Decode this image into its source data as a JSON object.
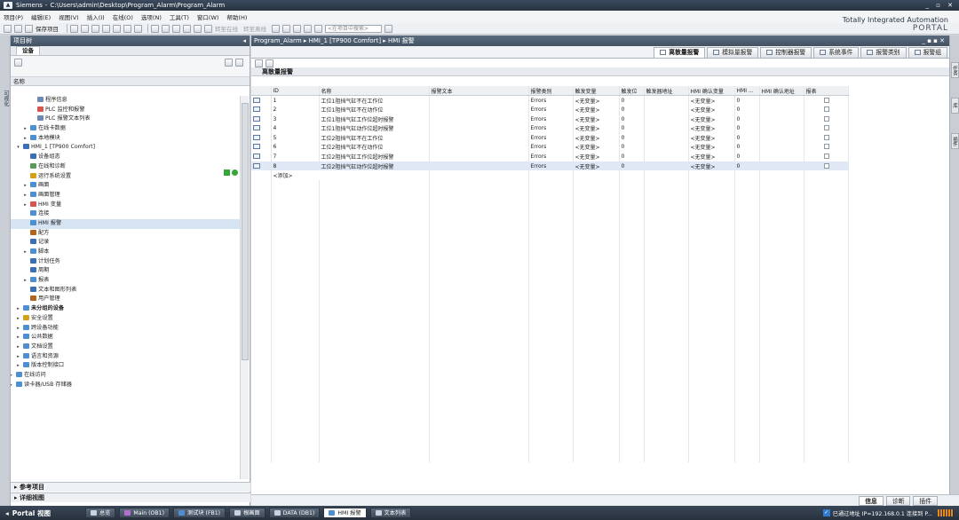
{
  "window": {
    "app": "Siemens",
    "path": "C:\\Users\\admin\\Desktop\\Program_Alarm\\Program_Alarm",
    "brand1": "Totally Integrated Automation",
    "brand2": "PORTAL"
  },
  "menu": [
    "项目(P)",
    "编辑(E)",
    "视图(V)",
    "插入(I)",
    "在线(O)",
    "选项(N)",
    "工具(T)",
    "窗口(W)",
    "帮助(H)"
  ],
  "toolbar": {
    "save": "保存项目",
    "online": "转至在线",
    "offline": "转至离线",
    "search_placeholder": "<在项目中搜索>"
  },
  "sidetab": "可视化",
  "project_tree": {
    "title": "项目树",
    "tab": "设备",
    "col_name": "名称",
    "items": [
      {
        "label": "程序信息",
        "level": 3,
        "arrow": "",
        "color": "#6e87b3"
      },
      {
        "label": "PLC 监控和报警",
        "level": 3,
        "arrow": "",
        "color": "#d9534f"
      },
      {
        "label": "PLC 报警文本列表",
        "level": 3,
        "arrow": "",
        "color": "#6e87b3"
      },
      {
        "label": "在线卡数据",
        "level": 2,
        "arrow": "▸",
        "color": "#4e8fd1"
      },
      {
        "label": "本地模块",
        "level": 2,
        "arrow": "▸",
        "color": "#4e8fd1"
      },
      {
        "label": "HMI_1 [TP900 Comfort]",
        "level": 1,
        "arrow": "▾",
        "color": "#3c70b5"
      },
      {
        "label": "设备组态",
        "level": 2,
        "arrow": "",
        "color": "#3c70b5"
      },
      {
        "label": "在线和诊断",
        "level": 2,
        "arrow": "",
        "color": "#5a9b5a"
      },
      {
        "label": "运行系统设置",
        "level": 2,
        "arrow": "",
        "color": "#d4a017"
      },
      {
        "label": "画面",
        "level": 2,
        "arrow": "▸",
        "color": "#4e8fd1"
      },
      {
        "label": "画面管理",
        "level": 2,
        "arrow": "▸",
        "color": "#4e8fd1"
      },
      {
        "label": "HMI 变量",
        "level": 2,
        "arrow": "▸",
        "color": "#d9534f"
      },
      {
        "label": "连接",
        "level": 2,
        "arrow": "",
        "color": "#4e8fd1"
      },
      {
        "label": "HMI 报警",
        "level": 2,
        "arrow": "",
        "color": "#4e8fd1",
        "selected": true
      },
      {
        "label": "配方",
        "level": 2,
        "arrow": "",
        "color": "#b0651d"
      },
      {
        "label": "记录",
        "level": 2,
        "arrow": "",
        "color": "#3c70b5"
      },
      {
        "label": "脚本",
        "level": 2,
        "arrow": "▸",
        "color": "#4e8fd1"
      },
      {
        "label": "计划任务",
        "level": 2,
        "arrow": "",
        "color": "#3c70b5"
      },
      {
        "label": "周期",
        "level": 2,
        "arrow": "",
        "color": "#3c70b5"
      },
      {
        "label": "报表",
        "level": 2,
        "arrow": "▸",
        "color": "#4e8fd1"
      },
      {
        "label": "文本和图形列表",
        "level": 2,
        "arrow": "",
        "color": "#3c70b5"
      },
      {
        "label": "用户管理",
        "level": 2,
        "arrow": "",
        "color": "#b0651d"
      },
      {
        "label": "未分组的设备",
        "level": 1,
        "arrow": "▸",
        "color": "#4e8fd1",
        "bold": true
      },
      {
        "label": "安全设置",
        "level": 1,
        "arrow": "▸",
        "color": "#d4a017"
      },
      {
        "label": "跨设备功能",
        "level": 1,
        "arrow": "▸",
        "color": "#4e8fd1"
      },
      {
        "label": "公共数据",
        "level": 1,
        "arrow": "▸",
        "color": "#4e8fd1"
      },
      {
        "label": "文档设置",
        "level": 1,
        "arrow": "▸",
        "color": "#4e8fd1"
      },
      {
        "label": "语言和资源",
        "level": 1,
        "arrow": "▸",
        "color": "#4e8fd1"
      },
      {
        "label": "版本控制接口",
        "level": 1,
        "arrow": "▸",
        "color": "#4e8fd1"
      },
      {
        "label": "在线访问",
        "level": 0,
        "arrow": "▸",
        "color": "#4e8fd1"
      },
      {
        "label": "读卡器/USB 存储器",
        "level": 0,
        "arrow": "▸",
        "color": "#4e8fd1"
      }
    ],
    "reference": "参考项目",
    "detail": "详细视图"
  },
  "editor": {
    "breadcrumb": [
      "Program_Alarm",
      "HMI_1 [TP900 Comfort]",
      "HMI 报警"
    ],
    "tabs": [
      "离散量报警",
      "模拟量报警",
      "控制器报警",
      "系统事件",
      "报警类别",
      "报警组"
    ],
    "active_tab": 0,
    "section": "离散量报警",
    "columns": [
      "",
      "ID",
      "名称",
      "报警文本",
      "报警类别",
      "触发变量",
      "触发位",
      "触发器地址",
      "HMI 确认变量",
      "HMI ...",
      "HMI 确认地址",
      "报表"
    ],
    "rows": [
      [
        "1",
        "工位1阻挡气缸不在工作位",
        "",
        "Errors",
        "<无变量>",
        "0",
        "",
        "<无变量>",
        "0"
      ],
      [
        "2",
        "工位1阻挡气缸不在动作位",
        "",
        "Errors",
        "<无变量>",
        "0",
        "",
        "<无变量>",
        "0"
      ],
      [
        "3",
        "工位1阻挡气缸工作位超时报警",
        "",
        "Errors",
        "<无变量>",
        "0",
        "",
        "<无变量>",
        "0"
      ],
      [
        "4",
        "工位1阻挡气缸动作位超时报警",
        "",
        "Errors",
        "<无变量>",
        "0",
        "",
        "<无变量>",
        "0"
      ],
      [
        "5",
        "工位2阻挡气缸不在工作位",
        "",
        "Errors",
        "<无变量>",
        "0",
        "",
        "<无变量>",
        "0"
      ],
      [
        "6",
        "工位2阻挡气缸不在动作位",
        "",
        "Errors",
        "<无变量>",
        "0",
        "",
        "<无变量>",
        "0"
      ],
      [
        "7",
        "工位2阻挡气缸工作位超时报警",
        "",
        "Errors",
        "<无变量>",
        "0",
        "",
        "<无变量>",
        "0"
      ],
      [
        "8",
        "工位2阻挡气缸动作位超时报警",
        "",
        "Errors",
        "<无变量>",
        "0",
        "",
        "<无变量>",
        "0"
      ]
    ],
    "add_row": "<添加>"
  },
  "bottom_tabs": [
    "信息",
    "诊断",
    "插件"
  ],
  "taskbar": {
    "portal": "Portal 视图",
    "tasks": [
      {
        "label": "总览",
        "color": "#c9d3de"
      },
      {
        "label": "Main (OB1)",
        "color": "#b56fd0"
      },
      {
        "label": "测试块 (FB1)",
        "color": "#4e8fd1"
      },
      {
        "label": "根画面",
        "color": "#c9d3de"
      },
      {
        "label": "DATA (DB1)",
        "color": "#c9d3de"
      },
      {
        "label": "HMI 报警",
        "color": "#4e8fd1",
        "active": true
      },
      {
        "label": "文本列表",
        "color": "#c9d3de"
      }
    ],
    "connection": "已通过地址 IP=192.168.0.1 连接到 P..."
  },
  "right_rail": [
    "任务",
    "库",
    "插件"
  ]
}
